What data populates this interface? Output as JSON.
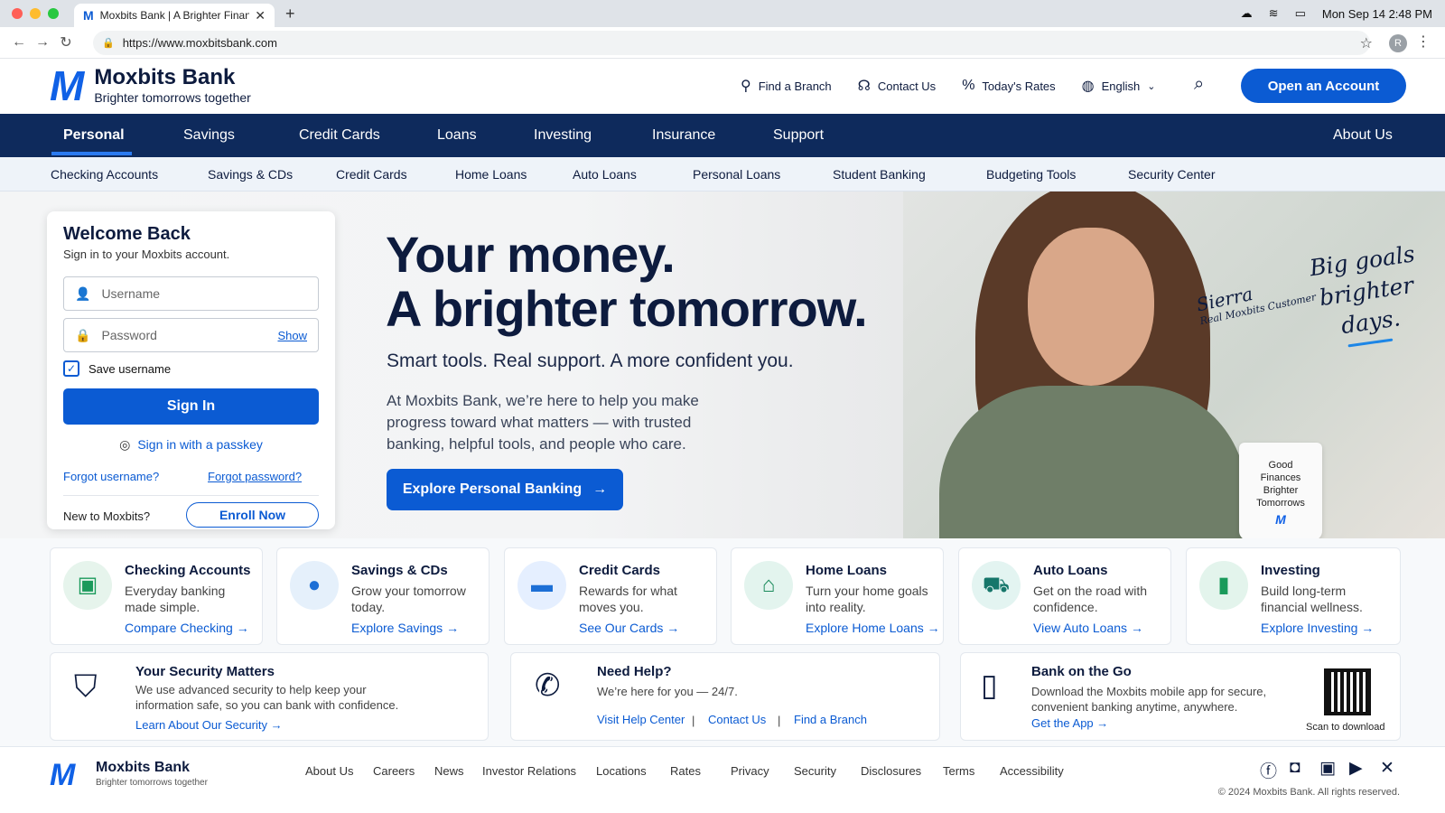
{
  "browser": {
    "tab_title": "Moxbits Bank | A Brighter Finan",
    "tab_favicon": "M",
    "url": "https://www.moxbitsbank.com",
    "profile_initial": "R",
    "clock": "Mon Sep 14  2:48 PM"
  },
  "header": {
    "logo_mark": "M",
    "bank_name": "Moxbits Bank",
    "tagline": "Brighter tomorrows together",
    "utilities": [
      {
        "icon": "map-pin-icon",
        "label": "Find a Branch"
      },
      {
        "icon": "headset-icon",
        "label": "Contact Us"
      },
      {
        "icon": "percent-icon",
        "label": "Today's Rates"
      },
      {
        "icon": "globe-icon",
        "label": "English"
      }
    ],
    "cta": "Open an Account"
  },
  "primary_nav": {
    "items": [
      "Personal",
      "Savings",
      "Credit Cards",
      "Loans",
      "Investing",
      "Insurance",
      "Support"
    ],
    "right": "About Us",
    "active": "Personal"
  },
  "secondary_nav": {
    "items": [
      "Checking Accounts",
      "Savings & CDs",
      "Credit Cards",
      "Home Loans",
      "Auto Loans",
      "Personal Loans",
      "Student Banking",
      "Budgeting Tools",
      "Security Center"
    ]
  },
  "login": {
    "title": "Welcome Back",
    "subtitle": "Sign in to your Moxbits account.",
    "username_placeholder": "Username",
    "password_placeholder": "Password",
    "show": "Show",
    "save_username": "Save username",
    "sign_in": "Sign In",
    "passkey": "Sign in with a passkey",
    "forgot_username": "Forgot username?",
    "forgot_password": "Forgot password?",
    "new_to": "New to Moxbits?",
    "enroll": "Enroll Now"
  },
  "hero": {
    "headline_1": "Your money.",
    "headline_2": "A brighter tomorrow.",
    "tagline": "Smart tools. Real support. A more confident you.",
    "body": "At Moxbits Bank, we’re here to help you make progress toward what matters — with trusted banking, helpful tools, and people who care.",
    "cta": "Explore Personal Banking",
    "signature_name": "Sierra",
    "signature_role": "Real Moxbits Customer",
    "quote_1": "Big goals",
    "quote_2": "brighter",
    "quote_3": "days.",
    "mug_1": "Good",
    "mug_2": "Finances",
    "mug_3": "Brighter",
    "mug_4": "Tomorrows",
    "mug_logo": "M"
  },
  "cards": [
    {
      "title": "Checking Accounts",
      "desc": "Everyday banking made simple.",
      "link": "Compare Checking",
      "icon": "wallet-icon",
      "bg": "#e6f4ec",
      "fg": "#1a9a5b"
    },
    {
      "title": "Savings & CDs",
      "desc": "Grow your tomorrow today.",
      "link": "Explore Savings",
      "icon": "piggy-bank-icon",
      "bg": "#e5f0fb",
      "fg": "#1d6fd6"
    },
    {
      "title": "Credit Cards",
      "desc": "Rewards for what moves you.",
      "link": "See Our Cards",
      "icon": "credit-card-icon",
      "bg": "#e5efff",
      "fg": "#1d6fd6"
    },
    {
      "title": "Home Loans",
      "desc": "Turn your home goals into reality.",
      "link": "Explore Home Loans",
      "icon": "house-icon",
      "bg": "#e3f4ee",
      "fg": "#1a8a5b"
    },
    {
      "title": "Auto Loans",
      "desc": "Get on the road with confidence.",
      "link": "View Auto Loans",
      "icon": "car-icon",
      "bg": "#e3f4f1",
      "fg": "#16766a"
    },
    {
      "title": "Investing",
      "desc": "Build long-term financial wellness.",
      "link": "Explore Investing",
      "icon": "bar-chart-icon",
      "bg": "#e3f4ec",
      "fg": "#1a9a5b"
    }
  ],
  "security": {
    "title": "Your Security Matters",
    "desc": "We use advanced security to help keep your information safe, so you can bank with confidence.",
    "link": "Learn About Our Security"
  },
  "help": {
    "title": "Need Help?",
    "desc": "We’re here for you — 24/7.",
    "links": [
      "Visit Help Center",
      "Contact Us",
      "Find a Branch"
    ]
  },
  "app": {
    "title": "Bank on the Go",
    "desc": "Download the Moxbits mobile app for secure, convenient banking anytime, anywhere.",
    "link": "Get the App",
    "qr_caption": "Scan to download"
  },
  "footer": {
    "bank_name": "Moxbits Bank",
    "tagline": "Brighter tomorrows together",
    "links": [
      "About Us",
      "Careers",
      "News",
      "Investor Relations",
      "Locations",
      "Rates",
      "Privacy",
      "Security",
      "Disclosures",
      "Terms",
      "Accessibility"
    ],
    "social": [
      "facebook-icon",
      "instagram-icon",
      "linkedin-icon",
      "youtube-icon",
      "x-icon"
    ],
    "copyright": "© 2024 Moxbits Bank. All rights reserved."
  }
}
